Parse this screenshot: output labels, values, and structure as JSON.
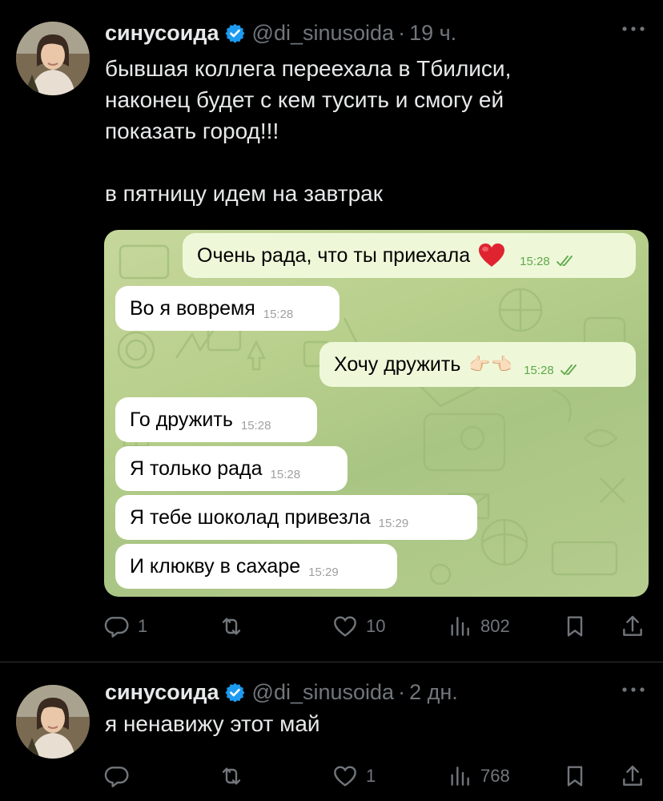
{
  "tweets": [
    {
      "author_name": "синусоида",
      "handle": "@di_sinusoida",
      "separator": "·",
      "time": "19 ч.",
      "text": "бывшая коллега переехала в Тбилиси,\nнаконец будет с кем тусить и смогу ей\nпоказать город!!!\n\nв пятницу идем на завтрак",
      "chat": [
        {
          "side": "out",
          "text": "Очень рада, что ты приехала",
          "time": "15:28",
          "emoji": "heart"
        },
        {
          "side": "in",
          "text": "Во я вовремя",
          "time": "15:28"
        },
        {
          "side": "out",
          "text": "Хочу дружить",
          "time": "15:28",
          "emoji": "👉🏻👈🏻"
        },
        {
          "side": "in",
          "text": "Го дружить",
          "time": "15:28"
        },
        {
          "side": "in",
          "text": "Я только рада",
          "time": "15:28"
        },
        {
          "side": "in",
          "text": "Я тебе шоколад привезла",
          "time": "15:29"
        },
        {
          "side": "in",
          "text": "И клюкву в сахаре",
          "time": "15:29"
        }
      ],
      "actions": {
        "replies": "1",
        "retweets": "",
        "likes": "10",
        "views": "802"
      }
    },
    {
      "author_name": "синусоида",
      "handle": "@di_sinusoida",
      "separator": "·",
      "time": "2 дн.",
      "text": "я ненавижу этот май",
      "actions": {
        "replies": "",
        "retweets": "",
        "likes": "1",
        "views": "768"
      }
    }
  ],
  "colors": {
    "background": "#000000",
    "text": "#e7e9ea",
    "muted": "#71767b",
    "verified": "#1d9bf0",
    "divider": "#2f3336"
  },
  "icons": [
    "verified-badge-icon",
    "more-icon",
    "reply-icon",
    "retweet-icon",
    "like-icon",
    "views-icon",
    "bookmark-icon",
    "share-icon"
  ]
}
